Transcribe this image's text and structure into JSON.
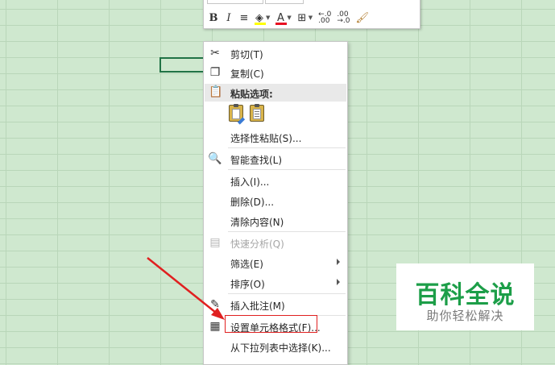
{
  "toolbar": {
    "bold": "B",
    "italic": "I",
    "align": "≡",
    "font_color": "A",
    "increase_decimal": "←.0\n.00",
    "decrease_decimal": ".00\n→.0"
  },
  "menu": {
    "cut": "剪切(T)",
    "copy": "复制(C)",
    "paste_options": "粘贴选项:",
    "paste_special": "选择性粘贴(S)...",
    "smart_lookup": "智能查找(L)",
    "insert": "插入(I)...",
    "delete": "删除(D)...",
    "clear_contents": "清除内容(N)",
    "quick_analysis": "快速分析(Q)",
    "filter": "筛选(E)",
    "sort": "排序(O)",
    "insert_comment": "插入批注(M)",
    "format_cells": "设置单元格格式(F)...",
    "pick_from_list": "从下拉列表中选择(K)..."
  },
  "watermark": {
    "title": "百科全说",
    "subtitle": "助你轻松解决"
  },
  "colors": {
    "grid_bg": "#cfe8cf",
    "selection": "#217346",
    "annotation": "#e02020",
    "watermark": "#1c9e48"
  }
}
